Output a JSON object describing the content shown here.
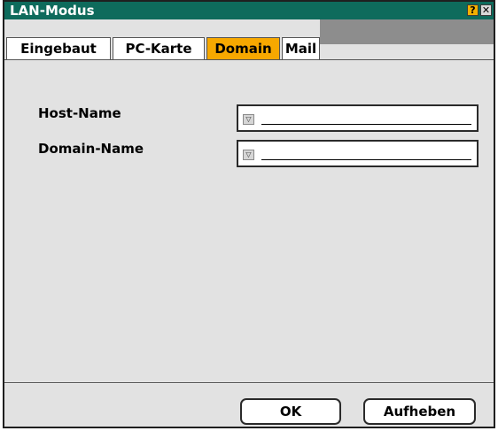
{
  "window": {
    "title": "LAN-Modus",
    "help_button": "?",
    "close_button": "✕"
  },
  "tabs": [
    {
      "label": "Eingebaut",
      "active": false
    },
    {
      "label": "PC-Karte",
      "active": false
    },
    {
      "label": "Domain",
      "active": true
    },
    {
      "label": "Mail",
      "active": false
    }
  ],
  "fields": {
    "host_name": {
      "label": "Host-Name",
      "value": ""
    },
    "domain_name": {
      "label": "Domain-Name",
      "value": ""
    }
  },
  "buttons": {
    "ok": "OK",
    "cancel": "Aufheben"
  },
  "colors": {
    "titlebar": "#0e6b5c",
    "active_tab": "#f7a800",
    "panel": "#e2e2e2"
  }
}
